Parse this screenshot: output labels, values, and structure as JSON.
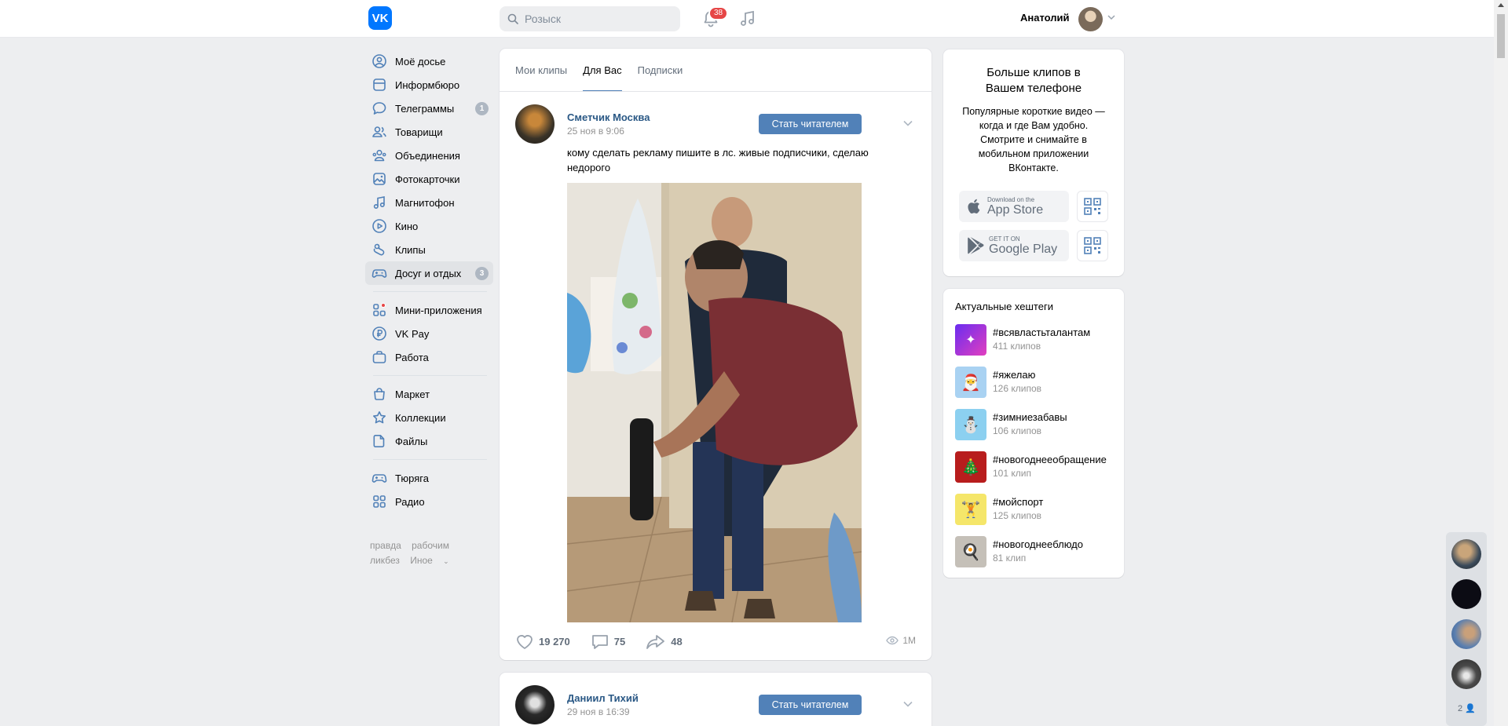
{
  "header": {
    "logo": "VK",
    "search_placeholder": "Розыск",
    "notifications_count": "38",
    "user_name": "Анатолий"
  },
  "nav": {
    "items": [
      {
        "label": "Моё досье"
      },
      {
        "label": "Информбюро"
      },
      {
        "label": "Телеграммы",
        "badge": "1"
      },
      {
        "label": "Товарищи"
      },
      {
        "label": "Объединения"
      },
      {
        "label": "Фотокарточки"
      },
      {
        "label": "Магнитофон"
      },
      {
        "label": "Кино"
      },
      {
        "label": "Клипы"
      },
      {
        "label": "Досуг и отдых",
        "badge": "3"
      },
      {
        "label": "Мини-приложения"
      },
      {
        "label": "VK Pay"
      },
      {
        "label": "Работа"
      },
      {
        "label": "Маркет"
      },
      {
        "label": "Коллекции"
      },
      {
        "label": "Файлы"
      },
      {
        "label": "Тюряга"
      },
      {
        "label": "Радио"
      }
    ],
    "footer": [
      "правда",
      "рабочим",
      "ликбез",
      "Иное"
    ]
  },
  "tabs": [
    "Мои клипы",
    "Для Вас",
    "Подписки"
  ],
  "posts": [
    {
      "author": "Сметчик Москва",
      "date": "25 ноя в 9:06",
      "follow": "Стать читателем",
      "text": "кому сделать рекламу пишите в лс. живые подписчики, сделаю недорого",
      "likes": "19 270",
      "comments": "75",
      "shares": "48",
      "views": "1M"
    },
    {
      "author": "Даниил Тихий",
      "date": "29 ноя в 16:39",
      "follow": "Стать читателем"
    }
  ],
  "promo": {
    "title": "Больше клипов в Вашем телефоне",
    "text": "Популярные короткие видео — когда и где Вам удобно. Смотрите и снимайте в мобильном приложении ВКонтакте.",
    "appstore_small": "Download on the",
    "appstore_big": "App Store",
    "gplay_small": "GET IT ON",
    "gplay_big": "Google Play"
  },
  "hashtags": {
    "title": "Актуальные хештеги",
    "items": [
      {
        "tag": "#всявластьталантам",
        "count": "411 клипов"
      },
      {
        "tag": "#яжелаю",
        "count": "126 клипов"
      },
      {
        "tag": "#зимниезабавы",
        "count": "106 клипов"
      },
      {
        "tag": "#новогоднееобращение",
        "count": "101 клип"
      },
      {
        "tag": "#мойспорт",
        "count": "125 клипов"
      },
      {
        "tag": "#новогоднеeблюдо",
        "count": "81 клип"
      }
    ]
  },
  "dock": {
    "count": "2"
  },
  "colors": {
    "accent": "#5181b8",
    "brand": "#0077ff",
    "badge_red": "#e64646"
  }
}
